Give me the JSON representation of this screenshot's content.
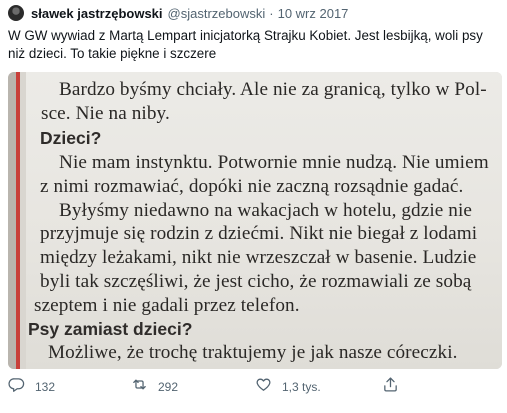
{
  "tweet": {
    "author_name": "sławek jastrzębowski",
    "author_handle": "@sjastrzebowski",
    "separator": "·",
    "date": "10 wrz 2017",
    "text": "W GW wywiad z Martą Lempart inicjatorką Strajku Kobiet. Jest lesbijką, woli psy niż dzieci. To takie piękne i szczere"
  },
  "photo": {
    "lines": [
      "Bardzo byśmy chciały. Ale nie za granicą, tylko w Pol-",
      "sce. Nie na niby.",
      "Dzieci?",
      "Nie mam instynktu. Potwornie mnie nudzą. Nie umiem",
      "z nimi rozmawiać, dopóki nie zaczną rozsądnie gadać.",
      "Byłyśmy niedawno na wakacjach w hotelu, gdzie nie",
      "przyjmuje się rodzin z dziećmi. Nikt nie biegał z lodami",
      "między leżakami, nikt nie wrzeszczał w basenie. Ludzie",
      "byli tak szczęśliwi, że jest cicho, że rozmawiali ze sobą",
      "szeptem i nie gadali przez telefon.",
      "Psy zamiast dzieci?",
      "Możliwe, że trochę traktujemy je jak nasze córeczki."
    ]
  },
  "actions": {
    "reply": {
      "icon": "reply-icon",
      "count": "132"
    },
    "retweet": {
      "icon": "retweet-icon",
      "count": "292"
    },
    "like": {
      "icon": "heart-icon",
      "count": "1,3 tys."
    },
    "share": {
      "icon": "share-icon"
    }
  },
  "colors": {
    "text": "#0f1419",
    "secondary": "#536471",
    "paper": "#e9e7e2",
    "margin_line": "#c8403a"
  }
}
